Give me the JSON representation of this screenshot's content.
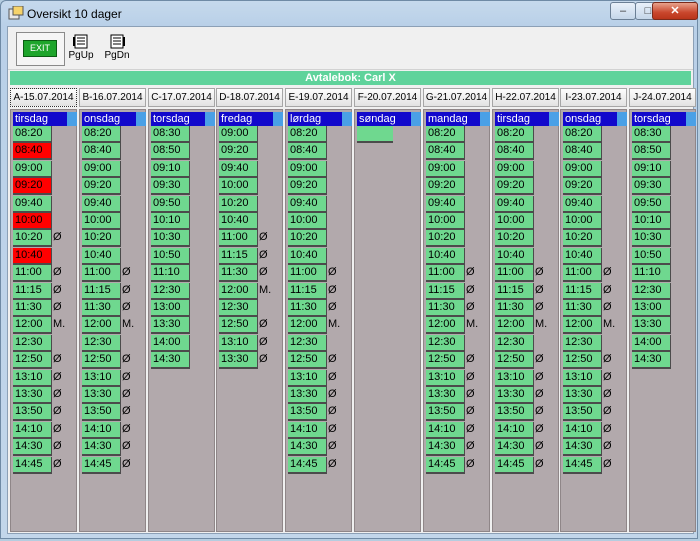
{
  "window": {
    "title": "Oversikt 10 dager",
    "min_glyph": "–",
    "max_glyph": "□",
    "close_glyph": "✕"
  },
  "toolbar": {
    "exit_label": "EXIT",
    "pgup_label": "PgUp",
    "pgdn_label": "PgDn"
  },
  "owner": {
    "label": "Avtalebok:  Carl X"
  },
  "colors": {
    "free": "#6fd88f",
    "busy": "#ff0000",
    "header": "#1208cc",
    "column_bg": "#b2a9ac",
    "owner_bar": "#5fd39b"
  },
  "days": [
    {
      "date": "A-15.07.2014",
      "day": "tirsdag",
      "slots": [
        {
          "time": "08:20"
        },
        {
          "time": "08:40",
          "status": "busy"
        },
        {
          "time": "09:00"
        },
        {
          "time": "09:20",
          "status": "busy"
        },
        {
          "time": "09:40"
        },
        {
          "time": "10:00",
          "status": "busy"
        },
        {
          "time": "10:20",
          "mark": "Ø"
        },
        {
          "time": "10:40",
          "status": "busy"
        },
        {
          "time": "11:00",
          "mark": "Ø"
        },
        {
          "time": "11:15",
          "mark": "Ø"
        },
        {
          "time": "11:30",
          "mark": "Ø"
        },
        {
          "time": "12:00",
          "mark": "M."
        },
        {
          "time": "12:30"
        },
        {
          "time": "12:50",
          "mark": "Ø"
        },
        {
          "time": "13:10",
          "mark": "Ø"
        },
        {
          "time": "13:30",
          "mark": "Ø"
        },
        {
          "time": "13:50",
          "mark": "Ø"
        },
        {
          "time": "14:10",
          "mark": "Ø"
        },
        {
          "time": "14:30",
          "mark": "Ø"
        },
        {
          "time": "14:45",
          "mark": "Ø"
        }
      ]
    },
    {
      "date": "B-16.07.2014",
      "day": "onsdag",
      "slots": [
        {
          "time": "08:20"
        },
        {
          "time": "08:40"
        },
        {
          "time": "09:00"
        },
        {
          "time": "09:20"
        },
        {
          "time": "09:40"
        },
        {
          "time": "10:00"
        },
        {
          "time": "10:20"
        },
        {
          "time": "10:40"
        },
        {
          "time": "11:00",
          "mark": "Ø"
        },
        {
          "time": "11:15",
          "mark": "Ø"
        },
        {
          "time": "11:30",
          "mark": "Ø"
        },
        {
          "time": "12:00",
          "mark": "M."
        },
        {
          "time": "12:30"
        },
        {
          "time": "12:50",
          "mark": "Ø"
        },
        {
          "time": "13:10",
          "mark": "Ø"
        },
        {
          "time": "13:30",
          "mark": "Ø"
        },
        {
          "time": "13:50",
          "mark": "Ø"
        },
        {
          "time": "14:10",
          "mark": "Ø"
        },
        {
          "time": "14:30",
          "mark": "Ø"
        },
        {
          "time": "14:45",
          "mark": "Ø"
        }
      ]
    },
    {
      "date": "C-17.07.2014",
      "day": "torsdag",
      "slots": [
        {
          "time": "08:30"
        },
        {
          "time": "08:50"
        },
        {
          "time": "09:10"
        },
        {
          "time": "09:30"
        },
        {
          "time": "09:50"
        },
        {
          "time": "10:10"
        },
        {
          "time": "10:30"
        },
        {
          "time": "10:50"
        },
        {
          "time": "11:10"
        },
        {
          "time": "12:30"
        },
        {
          "time": "13:00"
        },
        {
          "time": "13:30"
        },
        {
          "time": "14:00"
        },
        {
          "time": "14:30"
        }
      ]
    },
    {
      "date": "D-18.07.2014",
      "day": "fredag",
      "slots": [
        {
          "time": "09:00"
        },
        {
          "time": "09:20"
        },
        {
          "time": "09:40"
        },
        {
          "time": "10:00"
        },
        {
          "time": "10:20"
        },
        {
          "time": "10:40"
        },
        {
          "time": "11:00",
          "mark": "Ø"
        },
        {
          "time": "11:15",
          "mark": "Ø"
        },
        {
          "time": "11:30",
          "mark": "Ø"
        },
        {
          "time": "12:00",
          "mark": "M."
        },
        {
          "time": "12:30"
        },
        {
          "time": "12:50",
          "mark": "Ø"
        },
        {
          "time": "13:10",
          "mark": "Ø"
        },
        {
          "time": "13:30",
          "mark": "Ø"
        }
      ]
    },
    {
      "date": "E-19.07.2014",
      "day": "lørdag",
      "slots": [
        {
          "time": "08:20"
        },
        {
          "time": "08:40"
        },
        {
          "time": "09:00"
        },
        {
          "time": "09:20"
        },
        {
          "time": "09:40"
        },
        {
          "time": "10:00"
        },
        {
          "time": "10:20"
        },
        {
          "time": "10:40"
        },
        {
          "time": "11:00",
          "mark": "Ø"
        },
        {
          "time": "11:15",
          "mark": "Ø"
        },
        {
          "time": "11:30",
          "mark": "Ø"
        },
        {
          "time": "12:00",
          "mark": "M."
        },
        {
          "time": "12:30"
        },
        {
          "time": "12:50",
          "mark": "Ø"
        },
        {
          "time": "13:10",
          "mark": "Ø"
        },
        {
          "time": "13:30",
          "mark": "Ø"
        },
        {
          "time": "13:50",
          "mark": "Ø"
        },
        {
          "time": "14:10",
          "mark": "Ø"
        },
        {
          "time": "14:30",
          "mark": "Ø"
        },
        {
          "time": "14:45",
          "mark": "Ø"
        }
      ]
    },
    {
      "date": "F-20.07.2014",
      "day": "søndag",
      "slots": []
    },
    {
      "date": "G-21.07.2014",
      "day": "mandag",
      "slots": [
        {
          "time": "08:20"
        },
        {
          "time": "08:40"
        },
        {
          "time": "09:00"
        },
        {
          "time": "09:20"
        },
        {
          "time": "09:40"
        },
        {
          "time": "10:00"
        },
        {
          "time": "10:20"
        },
        {
          "time": "10:40"
        },
        {
          "time": "11:00",
          "mark": "Ø"
        },
        {
          "time": "11:15",
          "mark": "Ø"
        },
        {
          "time": "11:30",
          "mark": "Ø"
        },
        {
          "time": "12:00",
          "mark": "M."
        },
        {
          "time": "12:30"
        },
        {
          "time": "12:50",
          "mark": "Ø"
        },
        {
          "time": "13:10",
          "mark": "Ø"
        },
        {
          "time": "13:30",
          "mark": "Ø"
        },
        {
          "time": "13:50",
          "mark": "Ø"
        },
        {
          "time": "14:10",
          "mark": "Ø"
        },
        {
          "time": "14:30",
          "mark": "Ø"
        },
        {
          "time": "14:45",
          "mark": "Ø"
        }
      ]
    },
    {
      "date": "H-22.07.2014",
      "day": "tirsdag",
      "slots": [
        {
          "time": "08:20"
        },
        {
          "time": "08:40"
        },
        {
          "time": "09:00"
        },
        {
          "time": "09:20"
        },
        {
          "time": "09:40"
        },
        {
          "time": "10:00"
        },
        {
          "time": "10:20"
        },
        {
          "time": "10:40"
        },
        {
          "time": "11:00",
          "mark": "Ø"
        },
        {
          "time": "11:15",
          "mark": "Ø"
        },
        {
          "time": "11:30",
          "mark": "Ø"
        },
        {
          "time": "12:00",
          "mark": "M."
        },
        {
          "time": "12:30"
        },
        {
          "time": "12:50",
          "mark": "Ø"
        },
        {
          "time": "13:10",
          "mark": "Ø"
        },
        {
          "time": "13:30",
          "mark": "Ø"
        },
        {
          "time": "13:50",
          "mark": "Ø"
        },
        {
          "time": "14:10",
          "mark": "Ø"
        },
        {
          "time": "14:30",
          "mark": "Ø"
        },
        {
          "time": "14:45",
          "mark": "Ø"
        }
      ]
    },
    {
      "date": "I-23.07.2014",
      "day": "onsdag",
      "slots": [
        {
          "time": "08:20"
        },
        {
          "time": "08:40"
        },
        {
          "time": "09:00"
        },
        {
          "time": "09:20"
        },
        {
          "time": "09:40"
        },
        {
          "time": "10:00"
        },
        {
          "time": "10:20"
        },
        {
          "time": "10:40"
        },
        {
          "time": "11:00",
          "mark": "Ø"
        },
        {
          "time": "11:15",
          "mark": "Ø"
        },
        {
          "time": "11:30",
          "mark": "Ø"
        },
        {
          "time": "12:00",
          "mark": "M."
        },
        {
          "time": "12:30"
        },
        {
          "time": "12:50",
          "mark": "Ø"
        },
        {
          "time": "13:10",
          "mark": "Ø"
        },
        {
          "time": "13:30",
          "mark": "Ø"
        },
        {
          "time": "13:50",
          "mark": "Ø"
        },
        {
          "time": "14:10",
          "mark": "Ø"
        },
        {
          "time": "14:30",
          "mark": "Ø"
        },
        {
          "time": "14:45",
          "mark": "Ø"
        }
      ]
    },
    {
      "date": "J-24.07.2014",
      "day": "torsdag",
      "slots": [
        {
          "time": "08:30"
        },
        {
          "time": "08:50"
        },
        {
          "time": "09:10"
        },
        {
          "time": "09:30"
        },
        {
          "time": "09:50"
        },
        {
          "time": "10:10"
        },
        {
          "time": "10:30"
        },
        {
          "time": "10:50"
        },
        {
          "time": "11:10"
        },
        {
          "time": "12:30"
        },
        {
          "time": "13:00"
        },
        {
          "time": "13:30"
        },
        {
          "time": "14:00"
        },
        {
          "time": "14:30"
        }
      ]
    }
  ]
}
